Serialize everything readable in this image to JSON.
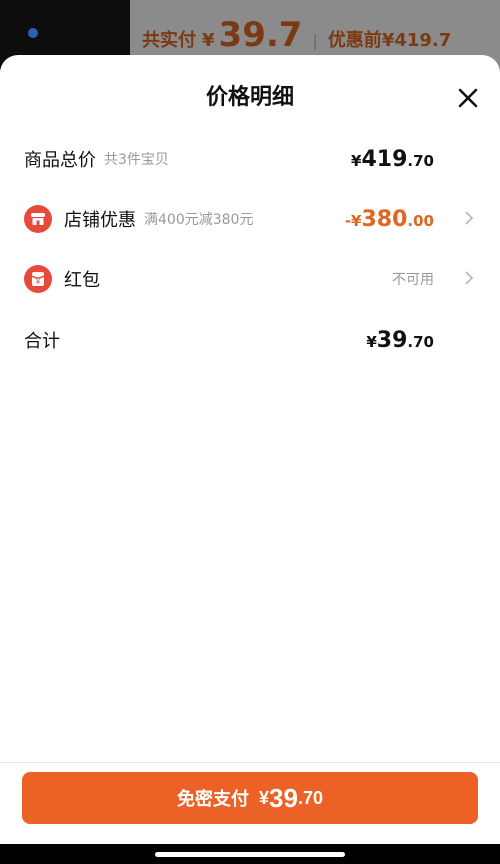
{
  "background": {
    "paid_label": "共实付",
    "paid_currency": "¥",
    "paid_amount": "39.7",
    "before_label": "优惠前",
    "before_amount": "¥419.7"
  },
  "sheet": {
    "title": "价格明细",
    "close_icon": "close-icon"
  },
  "rows": {
    "total": {
      "label": "商品总价",
      "hint": "共3件宝贝",
      "currency": "¥",
      "integer": "419",
      "decimal": ".70"
    },
    "store_discount": {
      "label": "店铺优惠",
      "hint": "满400元减380元",
      "currency": "-¥",
      "integer": "380",
      "decimal": ".00",
      "icon": "store-discount-icon",
      "accent": "#e0661f"
    },
    "red_packet": {
      "label": "红包",
      "status": "不可用",
      "icon": "red-packet-icon"
    },
    "sum": {
      "label": "合计",
      "currency": "¥",
      "integer": "39",
      "decimal": ".70"
    }
  },
  "footer": {
    "pay_label": "免密支付",
    "currency": "¥",
    "integer": "39",
    "decimal": ".70",
    "button_color": "#ec6226"
  }
}
